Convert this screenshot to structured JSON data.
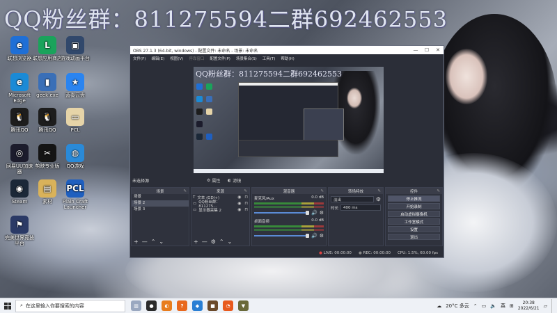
{
  "overlay": {
    "text": "QQ粉丝群：811275594二群692462553"
  },
  "desktop_icons": [
    {
      "label": "联想浏览器",
      "color": "#1f6fd6",
      "glyph": "e"
    },
    {
      "label": "联想应用商店",
      "color": "#1aa35b",
      "glyph": "L"
    },
    {
      "label": "游戏动画平台",
      "color": "#31486b",
      "glyph": "▣"
    },
    {
      "label": "Microsoft Edge",
      "color": "#1b8ad6",
      "glyph": "e"
    },
    {
      "label": "geek.exe",
      "color": "#3a6fb7",
      "glyph": "▮"
    },
    {
      "label": "蓝奏云盘",
      "color": "#2a84f0",
      "glyph": "★"
    },
    {
      "label": "腾讯QQ",
      "color": "#1d1d1d",
      "glyph": "🐧"
    },
    {
      "label": "腾讯QQ",
      "color": "#1d1d1d",
      "glyph": "🐧"
    },
    {
      "label": "PCL",
      "color": "#e6d4a8",
      "glyph": "▭"
    },
    {
      "label": "网易UU加速器",
      "color": "#1c1c2c",
      "glyph": "◎"
    },
    {
      "label": "剪映专业版",
      "color": "#141414",
      "glyph": "✂"
    },
    {
      "label": "QQ游戏",
      "color": "#2a8ad8",
      "glyph": "◍"
    },
    {
      "label": "Steam",
      "color": "#1b2838",
      "glyph": "◉"
    },
    {
      "label": "素材",
      "color": "#d9b25a",
      "glyph": "▤"
    },
    {
      "label": "Plain Craft Launcher",
      "color": "#1f5fbf",
      "glyph": "PCL"
    },
    {
      "label": "完美世界竞技平台",
      "color": "#2b3a66",
      "glyph": "⚑"
    }
  ],
  "obs": {
    "title": "OBS 27.1.3 (64-bit, windows) - 配置文件: 未命名 - 场景: 未命名",
    "menu": [
      "文件(F)",
      "编辑(E)",
      "视图(V)",
      "停靠窗口",
      "配置文件(P)",
      "场景集合(S)",
      "工具(T)",
      "帮助(H)"
    ],
    "window_buttons": [
      "—",
      "☐",
      "✕"
    ],
    "current_source_label": "未选择源",
    "properties_label": "属性",
    "filters_label": "滤镜",
    "docks": {
      "scenes": {
        "title": "场景",
        "items": [
          "场景",
          "场景 2",
          "场景 3"
        ],
        "selected": 1
      },
      "sources": {
        "title": "来源",
        "items": [
          {
            "icon": "T",
            "name": "文本 (GDI+)"
          },
          {
            "icon": "▭",
            "name": "QQ粉丝群：811275..."
          },
          {
            "icon": "▭",
            "name": "显示器采集 2"
          }
        ]
      },
      "mixer": {
        "title": "混音器",
        "channels": [
          {
            "name": "麦克风/Aux",
            "db": "0.0 dB"
          },
          {
            "name": "桌面音频",
            "db": "0.0 dB"
          }
        ]
      },
      "transitions": {
        "title": "转场特效",
        "type": "淡出",
        "duration_label": "时长",
        "duration": "400 ms"
      },
      "controls": {
        "title": "控件",
        "buttons": [
          "停止推流",
          "开始录制",
          "启动虚拟摄像机",
          "工作室模式",
          "设置",
          "退出"
        ]
      }
    },
    "status": {
      "live": "LIVE: 00:00:00",
      "rec": "REC: 00:00:00",
      "cpu": "CPU: 1.5%, 60.00 fps"
    }
  },
  "taskbar": {
    "search_placeholder": "在这里输入你要搜索的内容",
    "apps": [
      {
        "name": "城市",
        "color": "#9aa8c0",
        "glyph": "▥"
      },
      {
        "name": "OBS",
        "color": "#2b2b2b",
        "glyph": "●"
      },
      {
        "name": "应用",
        "color": "#e87d1e",
        "glyph": "◐"
      },
      {
        "name": "应用2",
        "color": "#e8681e",
        "glyph": "?"
      },
      {
        "name": "应用3",
        "color": "#2a7fd4",
        "glyph": "◆"
      },
      {
        "name": "应用4",
        "color": "#6b4a2a",
        "glyph": "■"
      },
      {
        "name": "应用5",
        "color": "#e85a1e",
        "glyph": "◔"
      },
      {
        "name": "应用6",
        "color": "#6a6a3a",
        "glyph": "▼"
      }
    ],
    "weather": "20°C 多云",
    "lang": "英",
    "time": "20:38",
    "date": "2022/6/21"
  }
}
